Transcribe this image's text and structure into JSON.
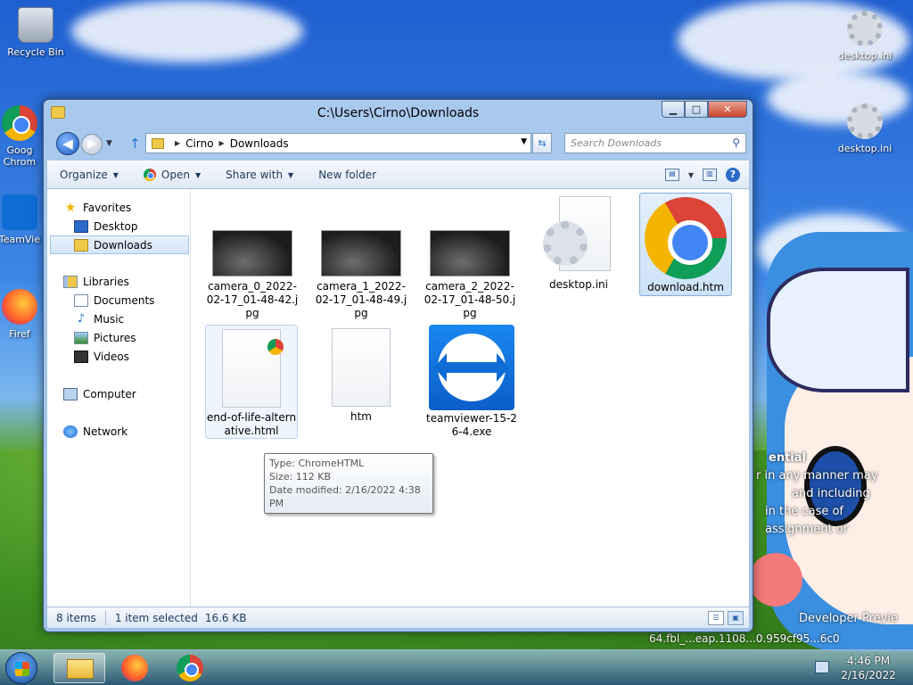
{
  "desktop": {
    "icons": {
      "recycle_bin": "Recycle Bin",
      "desktop_ini_1": "desktop.ini",
      "desktop_ini_2": "desktop.ini",
      "chrome_partial": "Goog Chrom",
      "teamviewer_partial": "TeamVie",
      "firefox_partial": "Firef"
    },
    "wallpaper_text": {
      "line1": "ential",
      "line2": "r in any manner may",
      "line3": "and including",
      "line4": "in the case of",
      "line5": "assignment or",
      "line6": "Developer Previe",
      "line7": "64.fbl_...eap.1108...0.959cf95...6c0"
    }
  },
  "window": {
    "title": "C:\\Users\\Cirno\\Downloads",
    "caption": {
      "minimize": "▁",
      "maximize": "□",
      "close": "✕"
    },
    "address": {
      "segments": [
        "Cirno",
        "Downloads"
      ]
    },
    "search": {
      "placeholder": "Search Downloads"
    },
    "toolbar": {
      "organize": "Organize",
      "open": "Open",
      "share_with": "Share with",
      "new_folder": "New folder"
    },
    "navpane": {
      "favorites": "Favorites",
      "desktop": "Desktop",
      "downloads": "Downloads",
      "libraries": "Libraries",
      "documents": "Documents",
      "music": "Music",
      "pictures": "Pictures",
      "videos": "Videos",
      "computer": "Computer",
      "network": "Network"
    },
    "files": [
      {
        "name": "camera_0_2022-02-17_01-48-42.jpg"
      },
      {
        "name": "camera_1_2022-02-17_01-48-49.jpg"
      },
      {
        "name": "camera_2_2022-02-17_01-48-50.jpg"
      },
      {
        "name": "desktop.ini"
      },
      {
        "name": "download.htm"
      },
      {
        "name": "end-of-life-alternative.html"
      },
      {
        "name": "htm"
      },
      {
        "name": "teamviewer-15-26-4.exe"
      }
    ],
    "tooltip": {
      "type": "Type: ChromeHTML",
      "size": "Size: 112 KB",
      "modified": "Date modified: 2/16/2022 4:38 PM"
    },
    "status": {
      "items": "8 items",
      "selected": "1 item selected",
      "size": "16.6 KB"
    }
  },
  "taskbar": {
    "time": "4:46 PM",
    "date": "2/16/2022"
  }
}
